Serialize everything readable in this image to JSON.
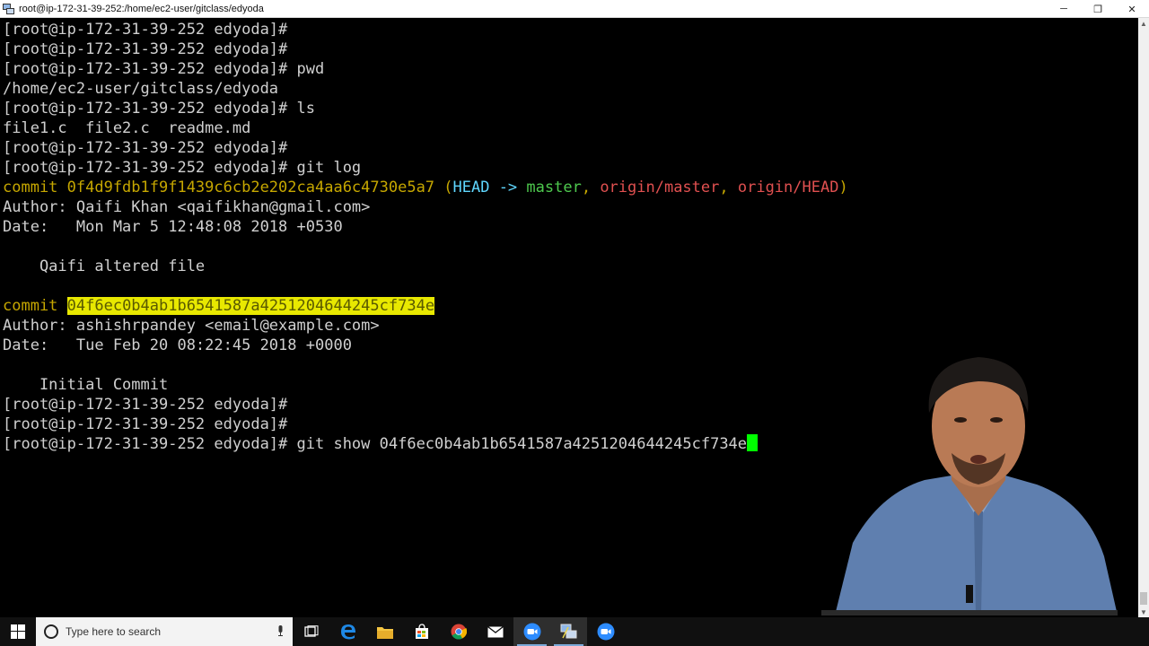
{
  "window": {
    "title": "root@ip-172-31-39-252:/home/ec2-user/gitclass/edyoda",
    "controls": {
      "minimize": "─",
      "restore": "❐",
      "close": "✕"
    }
  },
  "terminal": {
    "lines": [
      {
        "kind": "plain",
        "text": "[root@ip-172-31-39-252 edyoda]#"
      },
      {
        "kind": "plain",
        "text": "[root@ip-172-31-39-252 edyoda]#"
      },
      {
        "kind": "plain",
        "text": "[root@ip-172-31-39-252 edyoda]# pwd"
      },
      {
        "kind": "plain",
        "text": "/home/ec2-user/gitclass/edyoda"
      },
      {
        "kind": "plain",
        "text": "[root@ip-172-31-39-252 edyoda]# ls"
      },
      {
        "kind": "plain",
        "text": "file1.c  file2.c  readme.md"
      },
      {
        "kind": "plain",
        "text": "[root@ip-172-31-39-252 edyoda]#"
      },
      {
        "kind": "plain",
        "text": "[root@ip-172-31-39-252 edyoda]# git log"
      },
      {
        "kind": "commit1",
        "commit_label": "commit 0f4d9fdb1f9f1439c6cb2e202ca4aa6c4730e5a7 (",
        "head": "HEAD -> ",
        "master": "master",
        "sep1": ", ",
        "origin_master": "origin/master",
        "sep2": ", ",
        "origin_head": "origin/HEAD",
        "close": ")"
      },
      {
        "kind": "plain",
        "text": "Author: Qaifi Khan <qaifikhan@gmail.com>"
      },
      {
        "kind": "plain",
        "text": "Date:   Mon Mar 5 12:48:08 2018 +0530"
      },
      {
        "kind": "plain",
        "text": ""
      },
      {
        "kind": "plain",
        "text": "    Qaifi altered file"
      },
      {
        "kind": "plain",
        "text": ""
      },
      {
        "kind": "commit2",
        "commit_label": "commit ",
        "hash": "04f6ec0b4ab1b6541587a4251204644245cf734e"
      },
      {
        "kind": "plain",
        "text": "Author: ashishrpandey <email@example.com>"
      },
      {
        "kind": "plain",
        "text": "Date:   Tue Feb 20 08:22:45 2018 +0000"
      },
      {
        "kind": "plain",
        "text": ""
      },
      {
        "kind": "plain",
        "text": "    Initial Commit"
      },
      {
        "kind": "plain",
        "text": "[root@ip-172-31-39-252 edyoda]#"
      },
      {
        "kind": "plain",
        "text": "[root@ip-172-31-39-252 edyoda]#"
      },
      {
        "kind": "prompt_cursor",
        "text": "[root@ip-172-31-39-252 edyoda]# git show 04f6ec0b4ab1b6541587a4251204644245cf734e"
      }
    ]
  },
  "taskbar": {
    "search_placeholder": "Type here to search",
    "icons": [
      "windows-start-icon",
      "task-view-icon",
      "edge-icon",
      "file-explorer-icon",
      "store-icon",
      "chrome-icon",
      "mail-icon",
      "zoom-icon",
      "putty-icon",
      "zoom-meetings-icon"
    ]
  },
  "colors": {
    "terminal_bg": "#000000",
    "terminal_fg": "#d0d0d0",
    "commit_yellow": "#c6a700",
    "head_cyan": "#5fd7ff",
    "branch_green": "#4ec94e",
    "remote_red": "#e05050",
    "selection_bg": "#e8e800",
    "cursor": "#00ff00"
  }
}
